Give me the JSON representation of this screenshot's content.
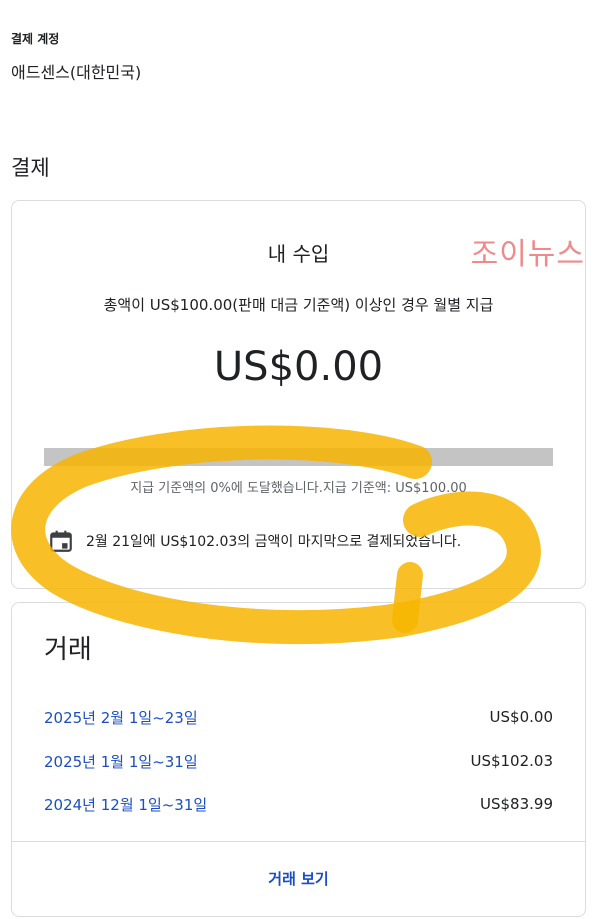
{
  "account": {
    "label": "결제 계정",
    "name": "애드센스(대한민국)"
  },
  "section": {
    "title": "결제"
  },
  "earnings": {
    "title": "내 수입",
    "watermark": "조이뉴스",
    "threshold_note": "총액이 US$100.00(판매 대금 기준액) 이상인 경우 월별 지급",
    "balance": "US$0.00",
    "progress_fraction": 0.0,
    "progress_text": "지급 기준액의 0%에 도달했습니다.지급 기준액: US$100.00",
    "last_payment_icon": "calendar-icon",
    "last_payment": "2월 21일에 US$102.03의 금액이 마지막으로 결제되었습니다."
  },
  "transactions": {
    "title": "거래",
    "rows": [
      {
        "period": "2025년 2월 1일~23일",
        "amount": "US$0.00"
      },
      {
        "period": "2025년 1월 1일~31일",
        "amount": "US$102.03"
      },
      {
        "period": "2024년 12월 1일~31일",
        "amount": "US$83.99"
      }
    ],
    "view_label": "거래 보기"
  },
  "colors": {
    "link": "#1a4fc1",
    "annotation_highlight": "#f7b500",
    "watermark": "#f08a8a"
  }
}
